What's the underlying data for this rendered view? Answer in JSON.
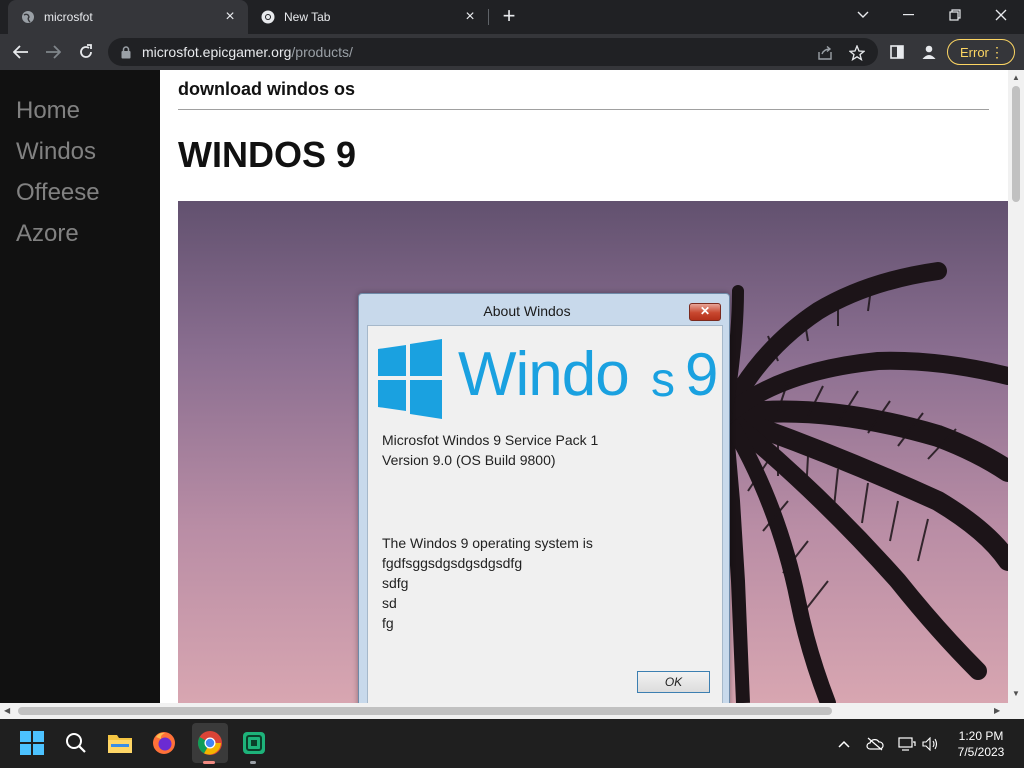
{
  "browser": {
    "tabs": [
      {
        "title": "microsfot"
      },
      {
        "title": "New Tab"
      }
    ],
    "address": {
      "domain": "microsfot.epicgamer.org",
      "path": "/products/"
    },
    "error_label": "Error"
  },
  "page": {
    "sidebar": {
      "items": [
        "Home",
        "Windos",
        "Offeese",
        "Azore"
      ]
    },
    "header": "download windos os",
    "title": "WINDOS 9"
  },
  "dialog": {
    "title": "About Windos",
    "close_label": "✕",
    "logo_text_left": "Windo",
    "logo_text_right": "s",
    "logo_version": "9",
    "version_line1": "Microsfot Windos 9 Service Pack 1",
    "version_line2": "Version 9.0 (OS Build 9800)",
    "desc_lines": [
      "The Windos 9 operating system is",
      "fgdfsggsdgsdgsdgsdfg",
      "sdfg",
      "sd",
      "fg"
    ],
    "ok_label": "OK"
  },
  "taskbar": {
    "time": "1:20 PM",
    "date": "7/5/2023"
  },
  "colors": {
    "logo_blue": "#1aa1e0",
    "error_yellow": "#fdd663"
  }
}
